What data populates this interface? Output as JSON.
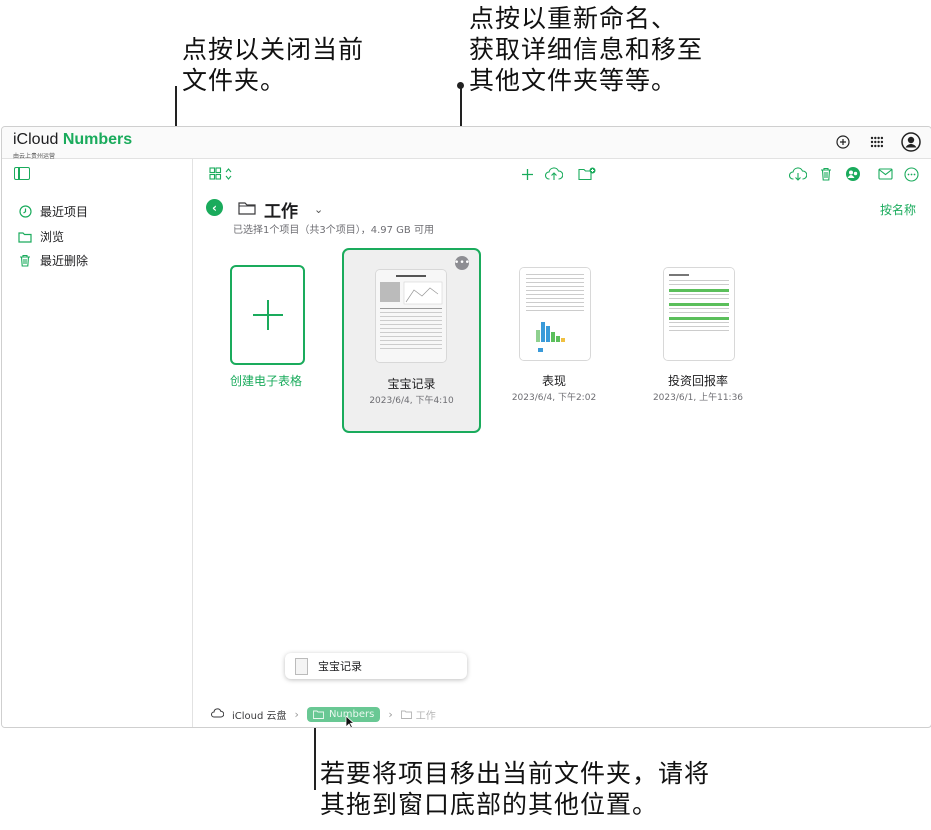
{
  "callouts": {
    "close_folder": "点按以关闭当前\n文件夹。",
    "rename": "点按以重新命名、\n获取详细信息和移至\n其他文件夹等等。",
    "move_out": "若要将项目移出当前文件夹，请将\n其拖到窗口底部的其他位置。"
  },
  "app": {
    "brand_icloud": "iCloud",
    "brand_numbers": "Numbers",
    "brand_sub": "由云上贵州运营"
  },
  "topbar": {
    "icons": [
      "plus-circle-icon",
      "app-grid-icon",
      "account-icon"
    ]
  },
  "sidebar": {
    "items": [
      {
        "label": "最近项目",
        "icon": "clock-icon"
      },
      {
        "label": "浏览",
        "icon": "folder-icon"
      },
      {
        "label": "最近删除",
        "icon": "trash-icon"
      }
    ]
  },
  "folder": {
    "name": "工作",
    "info": "已选择1个项目（共3个项目），4.97 GB 可用",
    "sort_label": "按名称"
  },
  "files": {
    "create_label": "创建电子表格",
    "items": [
      {
        "name": "宝宝记录",
        "date": "2023/6/4, 下午4:10"
      },
      {
        "name": "表现",
        "date": "2023/6/4, 下午2:02"
      },
      {
        "name": "投资回报率",
        "date": "2023/6/1, 上午11:36"
      }
    ]
  },
  "drag": {
    "label": "宝宝记录"
  },
  "breadcrumb": {
    "root": "iCloud 云盘",
    "middle": "Numbers",
    "current": "工作"
  },
  "colors": {
    "accent": "#1aab5c"
  }
}
